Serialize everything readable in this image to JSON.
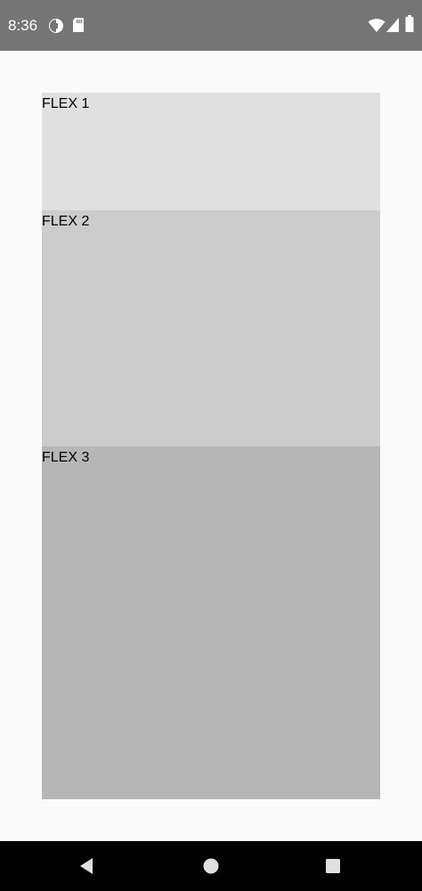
{
  "status_bar": {
    "time": "8:36",
    "icons": [
      "notification-icon",
      "sd-card-icon",
      "wifi-icon",
      "signal-icon",
      "battery-icon"
    ]
  },
  "flex_items": [
    {
      "label": "FLEX 1",
      "color": "#e0e0e0"
    },
    {
      "label": "FLEX 2",
      "color": "#cccccc"
    },
    {
      "label": "FLEX 3",
      "color": "#b6b6b6"
    }
  ],
  "nav_bar": {
    "buttons": [
      "back-icon",
      "home-icon",
      "recents-icon"
    ]
  },
  "colors": {
    "status_bar": "#757575",
    "background": "#fafafa",
    "nav_bar": "#000000"
  }
}
